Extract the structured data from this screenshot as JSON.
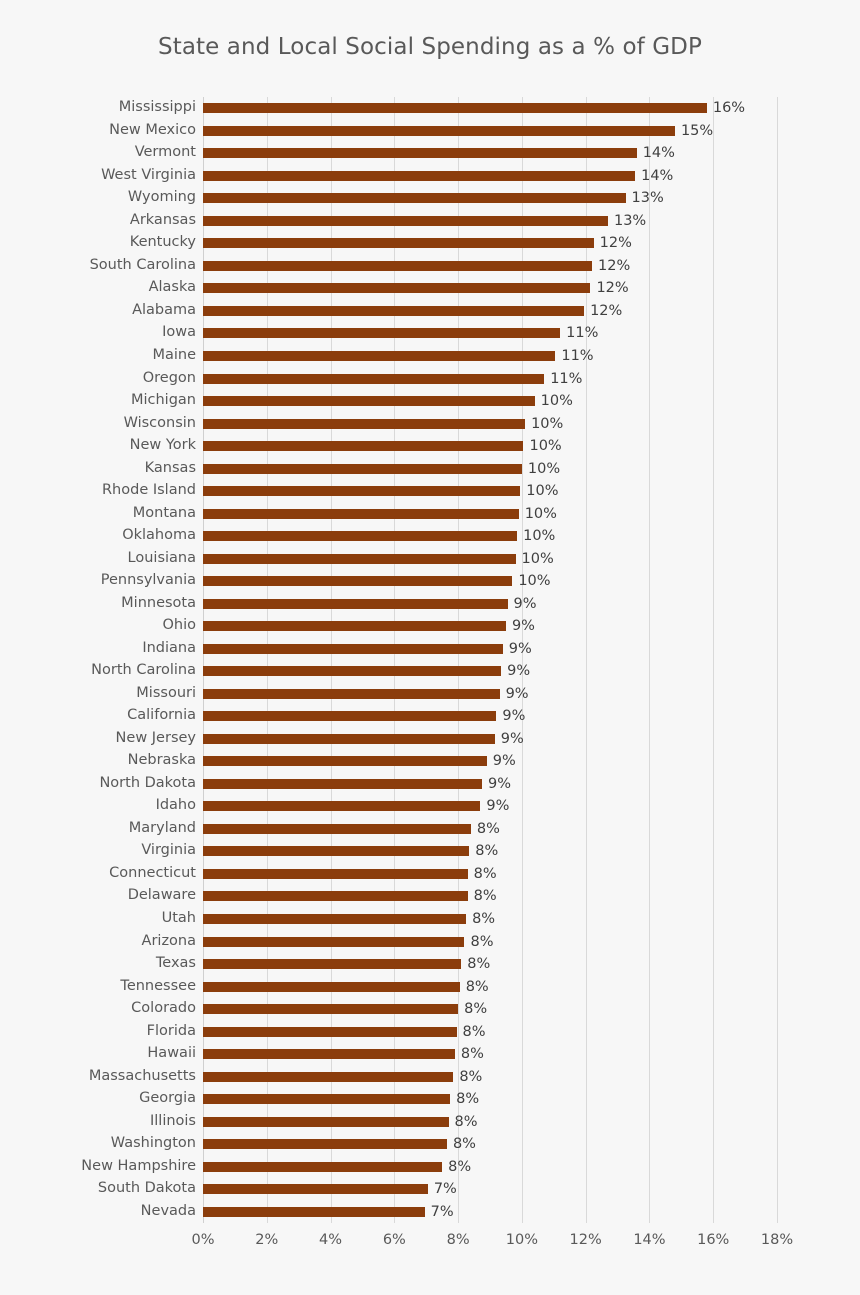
{
  "chart_data": {
    "type": "bar",
    "orientation": "horizontal",
    "title": "State and Local Social Spending as a % of GDP",
    "xlabel": "",
    "ylabel": "",
    "xlim": [
      0,
      18
    ],
    "xticks": [
      "0%",
      "2%",
      "4%",
      "6%",
      "8%",
      "10%",
      "12%",
      "14%",
      "16%",
      "18%"
    ],
    "xtick_values": [
      0,
      2,
      4,
      6,
      8,
      10,
      12,
      14,
      16,
      18
    ],
    "grid": true,
    "legend": false,
    "bar_color": "#8b3d0c",
    "label_color": "#595959",
    "value_label_color": "#404040",
    "background_color": "#f7f7f7",
    "categories": [
      "Mississippi",
      "New Mexico",
      "Vermont",
      "West Virginia",
      "Wyoming",
      "Arkansas",
      "Kentucky",
      "South Carolina",
      "Alaska",
      "Alabama",
      "Iowa",
      "Maine",
      "Oregon",
      "Michigan",
      "Wisconsin",
      "New York",
      "Kansas",
      "Rhode Island",
      "Montana",
      "Oklahoma",
      "Louisiana",
      "Pennsylvania",
      "Minnesota",
      "Ohio",
      "Indiana",
      "North Carolina",
      "Missouri",
      "California",
      "New Jersey",
      "Nebraska",
      "North Dakota",
      "Idaho",
      "Maryland",
      "Virginia",
      "Connecticut",
      "Delaware",
      "Utah",
      "Arizona",
      "Texas",
      "Tennessee",
      "Colorado",
      "Florida",
      "Hawaii",
      "Massachusetts",
      "Georgia",
      "Illinois",
      "Washington",
      "New Hampshire",
      "South Dakota",
      "Nevada"
    ],
    "values": [
      15.8,
      14.8,
      13.6,
      13.55,
      13.25,
      12.7,
      12.25,
      12.2,
      12.15,
      11.95,
      11.2,
      11.05,
      10.7,
      10.4,
      10.1,
      10.05,
      10.0,
      9.95,
      9.9,
      9.85,
      9.8,
      9.7,
      9.55,
      9.5,
      9.4,
      9.35,
      9.3,
      9.2,
      9.15,
      8.9,
      8.75,
      8.7,
      8.4,
      8.35,
      8.3,
      8.3,
      8.25,
      8.2,
      8.1,
      8.05,
      8.0,
      7.95,
      7.9,
      7.85,
      7.75,
      7.7,
      7.65,
      7.5,
      7.05,
      6.95
    ],
    "data_labels": [
      "16%",
      "15%",
      "14%",
      "14%",
      "13%",
      "13%",
      "12%",
      "12%",
      "12%",
      "12%",
      "11%",
      "11%",
      "11%",
      "10%",
      "10%",
      "10%",
      "10%",
      "10%",
      "10%",
      "10%",
      "10%",
      "10%",
      "9%",
      "9%",
      "9%",
      "9%",
      "9%",
      "9%",
      "9%",
      "9%",
      "9%",
      "9%",
      "8%",
      "8%",
      "8%",
      "8%",
      "8%",
      "8%",
      "8%",
      "8%",
      "8%",
      "8%",
      "8%",
      "8%",
      "8%",
      "8%",
      "8%",
      "8%",
      "7%",
      "7%"
    ]
  }
}
